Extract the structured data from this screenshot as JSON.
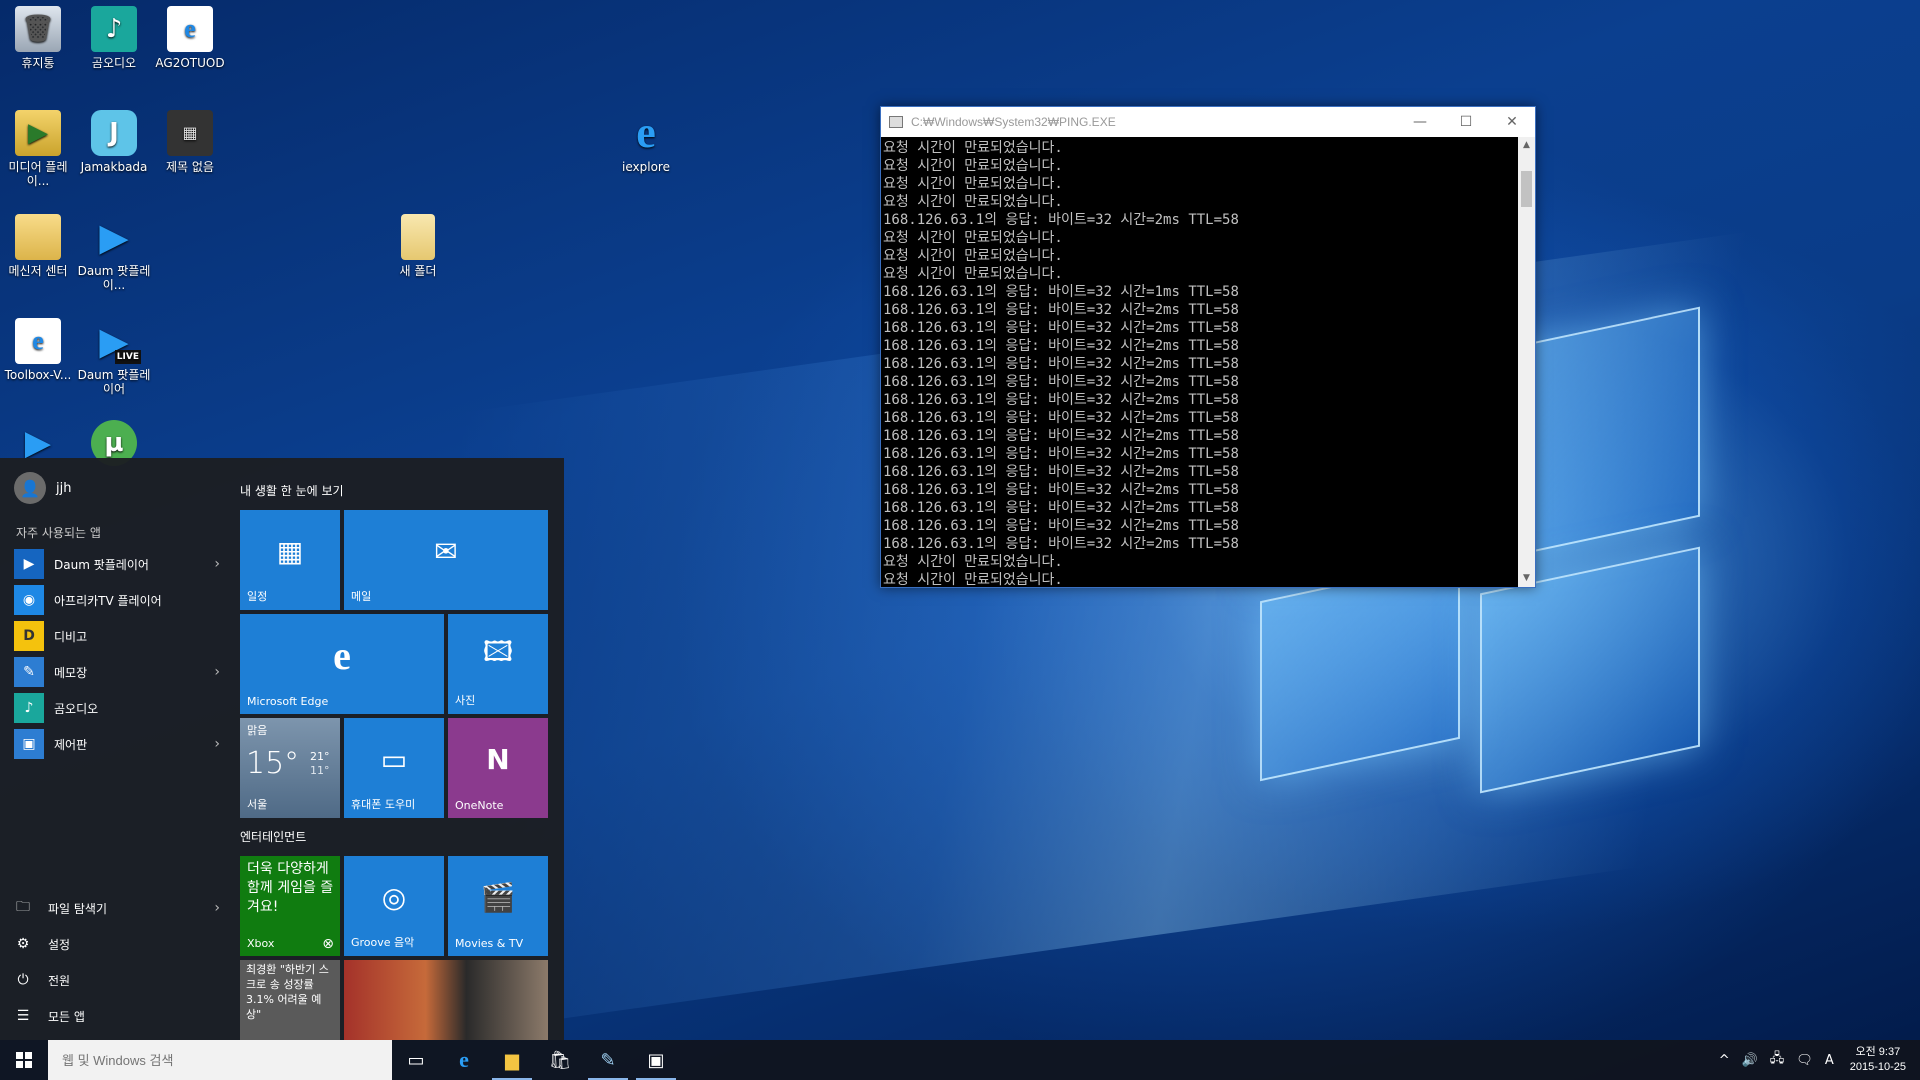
{
  "desktop": {
    "icons": [
      {
        "label": "휴지통",
        "icon": "recycle-bin-icon"
      },
      {
        "label": "곰오디오",
        "icon": "gom-audio-icon"
      },
      {
        "label": "AG2OTUOD",
        "icon": "internet-explorer-icon"
      },
      {
        "label": "미디어 플레이...",
        "icon": "media-player-icon"
      },
      {
        "label": "Jamakbada",
        "icon": "jamakbada-icon"
      },
      {
        "label": "제목 없음",
        "icon": "image-file-icon"
      },
      {
        "label": "iexplore",
        "icon": "internet-explorer-icon"
      },
      {
        "label": "메신저 센터",
        "icon": "folder-icon"
      },
      {
        "label": "Daum 팟플레이...",
        "icon": "potplayer-icon"
      },
      {
        "label": "새 폴더",
        "icon": "folder-icon"
      },
      {
        "label": "Toolbox-V...",
        "icon": "internet-explorer-icon"
      },
      {
        "label": "Daum 팟플레이어",
        "icon": "potplayer-live-icon"
      },
      {
        "label": "LIVE",
        "icon": "live-badge"
      }
    ]
  },
  "console": {
    "title": "C:₩Windows₩System32₩PING.EXE",
    "lines": [
      "요청 시간이 만료되었습니다.",
      "요청 시간이 만료되었습니다.",
      "요청 시간이 만료되었습니다.",
      "요청 시간이 만료되었습니다.",
      "168.126.63.1의 응답: 바이트=32 시간=2ms TTL=58",
      "요청 시간이 만료되었습니다.",
      "요청 시간이 만료되었습니다.",
      "요청 시간이 만료되었습니다.",
      "168.126.63.1의 응답: 바이트=32 시간=1ms TTL=58",
      "168.126.63.1의 응답: 바이트=32 시간=2ms TTL=58",
      "168.126.63.1의 응답: 바이트=32 시간=2ms TTL=58",
      "168.126.63.1의 응답: 바이트=32 시간=2ms TTL=58",
      "168.126.63.1의 응답: 바이트=32 시간=2ms TTL=58",
      "168.126.63.1의 응답: 바이트=32 시간=2ms TTL=58",
      "168.126.63.1의 응답: 바이트=32 시간=2ms TTL=58",
      "168.126.63.1의 응답: 바이트=32 시간=2ms TTL=58",
      "168.126.63.1의 응답: 바이트=32 시간=2ms TTL=58",
      "168.126.63.1의 응답: 바이트=32 시간=2ms TTL=58",
      "168.126.63.1의 응답: 바이트=32 시간=2ms TTL=58",
      "168.126.63.1의 응답: 바이트=32 시간=2ms TTL=58",
      "168.126.63.1의 응답: 바이트=32 시간=2ms TTL=58",
      "168.126.63.1의 응답: 바이트=32 시간=2ms TTL=58",
      "168.126.63.1의 응답: 바이트=32 시간=2ms TTL=58",
      "요청 시간이 만료되었습니다.",
      "요청 시간이 만료되었습니다."
    ]
  },
  "start_menu": {
    "user": "jjh",
    "most_used_label": "자주 사용되는 앱",
    "apps": [
      {
        "label": "Daum 팟플레이어",
        "icon": "potplayer-icon",
        "has_submenu": true
      },
      {
        "label": "아프리카TV 플레이어",
        "icon": "afreecatv-icon",
        "has_submenu": false
      },
      {
        "label": "디비고",
        "icon": "dibigo-icon",
        "has_submenu": false
      },
      {
        "label": "메모장",
        "icon": "notepad-icon",
        "has_submenu": true
      },
      {
        "label": "곰오디오",
        "icon": "gom-audio-icon",
        "has_submenu": false
      },
      {
        "label": "제어판",
        "icon": "control-panel-icon",
        "has_submenu": true
      }
    ],
    "bottom": [
      {
        "label": "파일 탐색기",
        "icon": "file-explorer-icon",
        "has_submenu": true
      },
      {
        "label": "설정",
        "icon": "gear-icon",
        "has_submenu": false
      },
      {
        "label": "전원",
        "icon": "power-icon",
        "has_submenu": false
      },
      {
        "label": "모든 앱",
        "icon": "all-apps-icon",
        "has_submenu": false
      }
    ],
    "group1_label": "내 생활 한 눈에 보기",
    "group2_label": "엔터테인먼트",
    "tiles": {
      "calendar": "일정",
      "mail": "메일",
      "edge": "Microsoft Edge",
      "photos": "사진",
      "weather_condition": "맑음",
      "weather_temp": "15°",
      "weather_high": "21°",
      "weather_low": "11°",
      "weather_city": "서울",
      "phone": "휴대폰 도우미",
      "onenote": "OneNote",
      "xbox_text": "더욱 다양하게 함께 게임을 즐겨요!",
      "xbox": "Xbox",
      "groove": "Groove 음악",
      "movies": "Movies & TV",
      "news_text": "최경환 \"하반기 스크로 송 성장률 3.1% 어려울 예상\""
    },
    "colors": {
      "tile_blue": "#1e7fd6",
      "onenote": "#8b3a8e",
      "xbox": "#107c10",
      "accent": "#2d7dd2"
    }
  },
  "taskbar": {
    "search_placeholder": "웹 및 Windows 검색",
    "tray_ime": "A",
    "time": "오전 9:37",
    "date": "2015-10-25"
  }
}
